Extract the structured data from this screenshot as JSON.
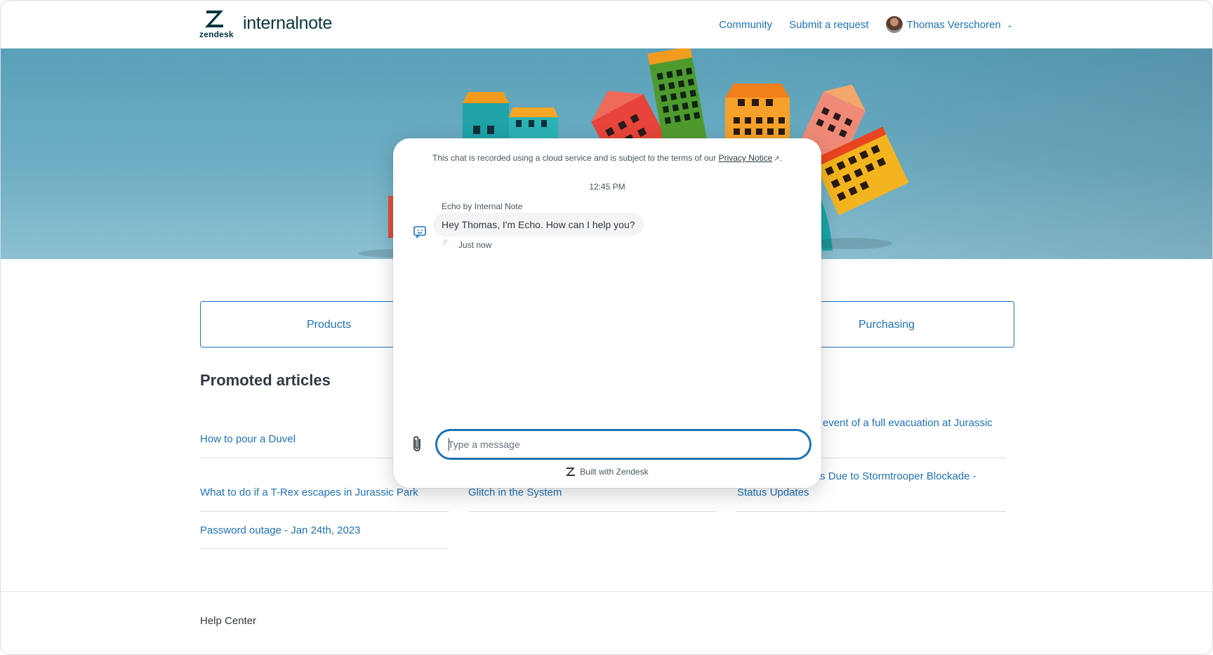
{
  "header": {
    "logo_wordmark": "zendesk",
    "brand_name": "internalnote",
    "nav": [
      "Community",
      "Submit a request"
    ],
    "user_name": "Thomas Verschoren"
  },
  "categories": [
    "Products",
    "Purchasing"
  ],
  "promoted": {
    "title": "Promoted articles",
    "col1": [
      "How to pour a Duvel",
      "What to do if a T-Rex escapes in Jurassic Park",
      "Password outage - Jan 24th, 2023"
    ],
    "col2": [
      "Glitch in the System"
    ],
    "col3_line1": "event of a full evacuation at Jurassic",
    "col3_line2a": "ts Due to Stormtrooper Blockade -",
    "col3_line2b": "Status Updates"
  },
  "footer": {
    "label": "Help Center"
  },
  "chat": {
    "notice_prefix": "This chat is recorded using a cloud service and is subject to the terms of our",
    "notice_link": "Privacy Notice",
    "notice_suffix": ".",
    "timestamp": "12:45 PM",
    "sender": "Echo by Internal Note",
    "message": "Hey Thomas, I'm Echo. How can I help you?",
    "status": "Just now",
    "input_placeholder": "Type a message",
    "powered_by": "Built with Zendesk"
  },
  "colors": {
    "link": "#1f73b7",
    "text": "#2f3941",
    "hero": "#5aa0b8"
  }
}
